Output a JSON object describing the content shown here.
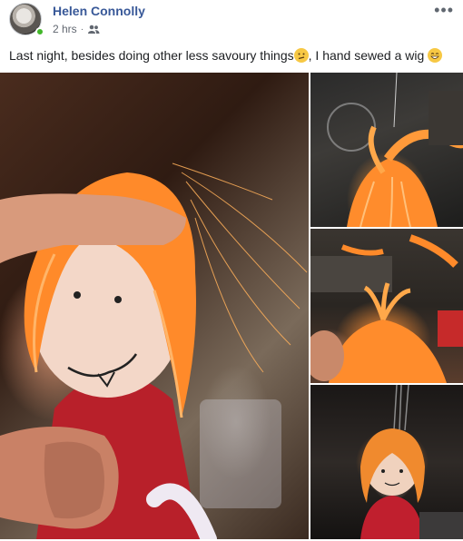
{
  "post": {
    "author": "Helen Connolly",
    "time": "2 hrs",
    "separator": "·",
    "privacy_icon": "friends-icon",
    "more_label": "•••",
    "text_before": "Last night, besides doing other less savoury things",
    "text_middle": ", I hand sewed a wig ",
    "emoji_1": "confused-face-emoji",
    "emoji_2": "grinning-face-emoji"
  },
  "photos": [
    {
      "name": "doll-wig-closeup"
    },
    {
      "name": "wig-sewing-top"
    },
    {
      "name": "wig-sewing-middle"
    },
    {
      "name": "doll-wig-finished"
    }
  ],
  "colors": {
    "name_link": "#385898",
    "meta_text": "#616770",
    "online": "#42b72a",
    "wig_orange": "#ff8a2a"
  }
}
